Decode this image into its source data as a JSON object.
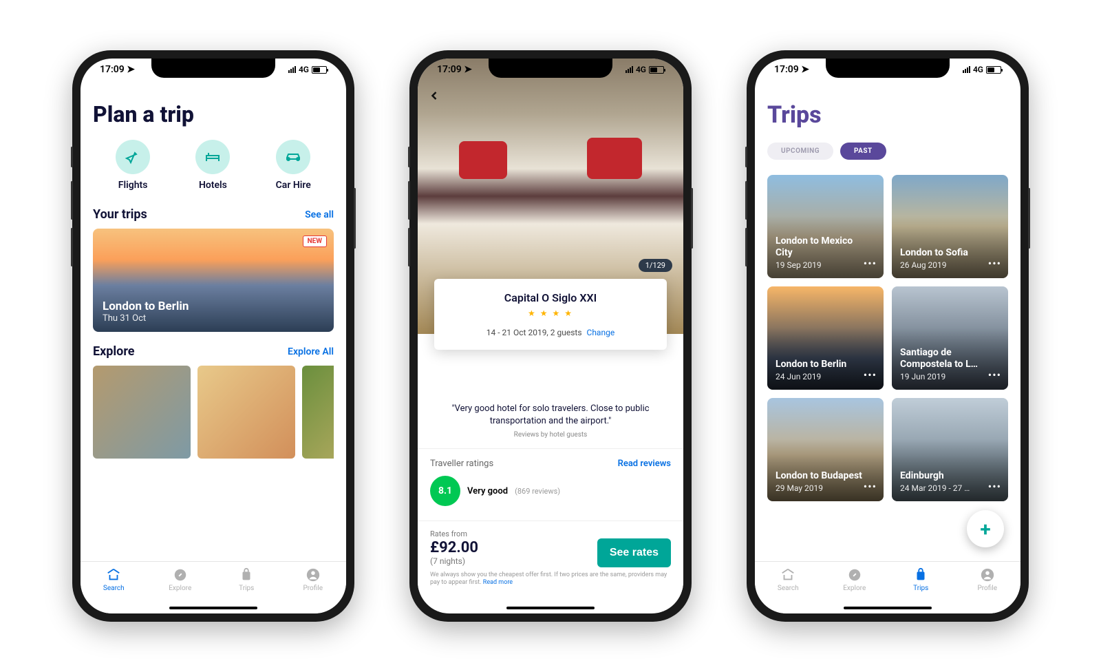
{
  "status": {
    "time": "17:09",
    "network": "4G"
  },
  "phone1": {
    "title": "Plan a trip",
    "categories": {
      "flights": "Flights",
      "hotels": "Hotels",
      "carhire": "Car Hire"
    },
    "your_trips_heading": "Your trips",
    "see_all": "See all",
    "trip_card": {
      "new": "NEW",
      "title": "London to Berlin",
      "sub": "Thu 31 Oct"
    },
    "explore_heading": "Explore",
    "explore_all": "Explore All"
  },
  "phone2": {
    "img_counter": "1/129",
    "hotel_name": "Capital O Siglo XXI",
    "dates": "14 - 21 Oct 2019, 2 guests",
    "change": "Change",
    "quote": "\"Very good hotel for solo travelers. Close to public transportation and the airport.\"",
    "quote_sub": "Reviews by hotel guests",
    "ratings_label": "Traveller ratings",
    "read_reviews": "Read reviews",
    "rating_score": "8.1",
    "rating_text": "Very good",
    "rating_count": "(869 reviews)",
    "rates_from": "Rates from",
    "price": "£92.00",
    "nights": "(7 nights)",
    "see_rates": "See rates",
    "disclaimer": "We always show you the cheapest offer first. If two prices are the same, providers may pay to appear first. ",
    "read_more": "Read more"
  },
  "phone3": {
    "title": "Trips",
    "tab_upcoming": "UPCOMING",
    "tab_past": "PAST",
    "trips": [
      {
        "title": "London to Mexico City",
        "date": "19 Sep 2019"
      },
      {
        "title": "London to Sofia",
        "date": "26 Aug 2019"
      },
      {
        "title": "London to Berlin",
        "date": "24 Jun 2019"
      },
      {
        "title": "Santiago de Compostela to L…",
        "date": "19 Jun 2019"
      },
      {
        "title": "London to Budapest",
        "date": "29 May 2019"
      },
      {
        "title": "Edinburgh",
        "date": "24 Mar 2019 - 27 …"
      }
    ]
  },
  "tabs": {
    "search": "Search",
    "explore": "Explore",
    "trips": "Trips",
    "profile": "Profile"
  }
}
